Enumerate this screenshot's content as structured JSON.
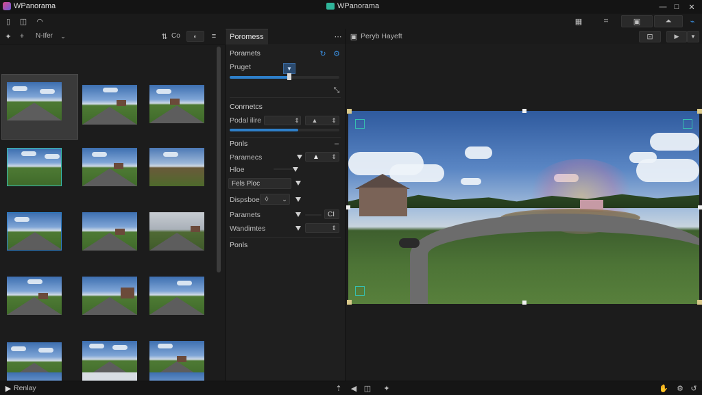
{
  "app": {
    "title": "WPanorama",
    "center_title": "WPanorama"
  },
  "toolbar": {
    "left_filter": "N-Ifer",
    "left_mode": "Co"
  },
  "mid_panel": {
    "tab_label": "Poromess",
    "section1_title": "Poramets",
    "row_preset": "Pruget",
    "section2_title": "Conrnetcs",
    "row_pedal": "Podal ilire",
    "section3_title": "Ponls",
    "row_parameters": "Paramecs",
    "row_hide": "Hloe",
    "field_fela": "Fels Ploc",
    "row_dispsoe": "Dispsboe",
    "row_parameters2": "Paramets",
    "field_ct": "CI",
    "row_wandinites": "Wandimtes",
    "section4_title": "Ponls",
    "slider1_value": 0.62,
    "slider2_value": 0.62
  },
  "right_panel": {
    "tab_label": "Peryb Hayeft"
  },
  "statusbar": {
    "left_text": "Renlay"
  },
  "colors": {
    "accent": "#2e7fc9",
    "teal": "#37c0b0",
    "bg": "#1b1b1b"
  }
}
